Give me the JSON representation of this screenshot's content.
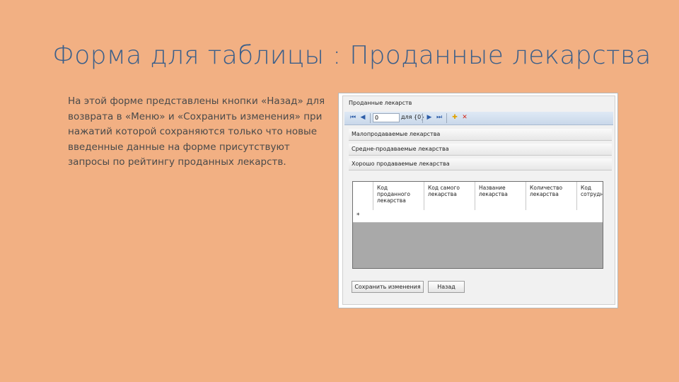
{
  "slide": {
    "title": "Форма для таблицы : Проданные лекарства",
    "body": "На этой форме представлены кнопки «Назад» для возврата в «Меню» и «Сохранить изменения» при нажатий которой сохраняются только что новые введенные данные на форме присутствуют запросы по рейтингу проданных лекарств."
  },
  "form": {
    "title": "Проданные лекарств",
    "toolbar": {
      "first_icon": "⏮",
      "prev_icon": "◀",
      "position_value": "0",
      "of_label": "для {0}",
      "next_icon": "▶",
      "last_icon": "⏭",
      "add_icon": "✚",
      "delete_icon": "✕"
    },
    "queries": [
      "Малопродаваемые лекарства",
      "Средне-продаваемые лекарства",
      "Хорошо продаваемые лекарства"
    ],
    "grid": {
      "columns": [
        "Код проданного лекарства",
        "Код самого лекарства",
        "Название лекарства",
        "Количество лекарства",
        "Код сотрудн"
      ],
      "new_row_marker": "*"
    },
    "buttons": {
      "save": "Сохранить изменения",
      "back": "Назад"
    }
  },
  "colors": {
    "background": "#f2b083",
    "title": "#3b5f8a",
    "body_text": "#4a4a4a"
  }
}
